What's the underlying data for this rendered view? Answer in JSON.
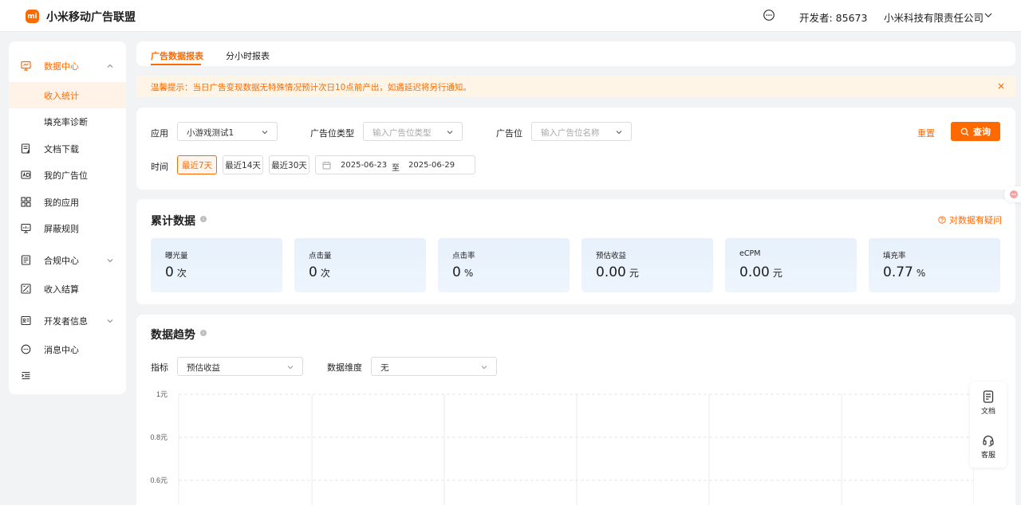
{
  "header": {
    "logo_text": "mi",
    "app_title": "小米移动广告联盟",
    "developer": "开发者: 85673",
    "company": "小米科技有限责任公司"
  },
  "sidebar": {
    "items": [
      {
        "label": "数据中心",
        "icon": "monitor-icon"
      },
      {
        "label": "收入统计"
      },
      {
        "label": "填充率诊断"
      },
      {
        "label": "文档下载",
        "icon": "document-download-icon"
      },
      {
        "label": "我的广告位",
        "icon": "ad-slot-icon"
      },
      {
        "label": "我的应用",
        "icon": "apps-grid-icon"
      },
      {
        "label": "屏蔽规则",
        "icon": "shield-rule-icon"
      },
      {
        "label": "合规中心",
        "icon": "compliance-icon"
      },
      {
        "label": "收入结算",
        "icon": "settlement-icon"
      },
      {
        "label": "开发者信息",
        "icon": "developer-card-icon"
      },
      {
        "label": "消息中心",
        "icon": "chat-icon"
      }
    ]
  },
  "tabs": [
    {
      "label": "广告数据报表",
      "active": true
    },
    {
      "label": "分小时报表",
      "active": false
    }
  ],
  "notice": {
    "text": "温馨提示：当日广告变现数据无特殊情况预计次日10点前产出，如遇延迟将另行通知。"
  },
  "filters": {
    "app_label": "应用",
    "app_value": "小游戏测试1",
    "slot_type_label": "广告位类型",
    "slot_type_placeholder": "输入广告位类型",
    "slot_label": "广告位",
    "slot_placeholder": "输入广告位名称",
    "reset_label": "重置",
    "query_label": "查询",
    "time_label": "时间",
    "time_options": [
      "最近7天",
      "最近14天",
      "最近30天"
    ],
    "date_start": "2025-06-23",
    "date_sep": "至",
    "date_end": "2025-06-29"
  },
  "summary": {
    "title": "累计数据",
    "question_link": "对数据有疑问",
    "stats": [
      {
        "label": "曝光量",
        "value": "0",
        "unit": "次"
      },
      {
        "label": "点击量",
        "value": "0",
        "unit": "次"
      },
      {
        "label": "点击率",
        "value": "0",
        "unit": "%"
      },
      {
        "label": "预估收益",
        "value": "0.00",
        "unit": "元"
      },
      {
        "label": "eCPM",
        "value": "0.00",
        "unit": "元"
      },
      {
        "label": "填充率",
        "value": "0.77",
        "unit": "%"
      }
    ]
  },
  "trend": {
    "title": "数据趋势",
    "metric_label": "指标",
    "metric_value": "预估收益",
    "dimension_label": "数据维度",
    "dimension_value": "无"
  },
  "float_panel": {
    "docs_label": "文档",
    "service_label": "客服"
  },
  "chart_data": {
    "type": "line",
    "y_ticks": [
      "1元",
      "0.8元",
      "0.6元"
    ],
    "ylim": [
      0,
      1
    ],
    "grid": true,
    "x": [],
    "series": []
  },
  "colors": {
    "accent": "#ff6900",
    "notice_bg": "#fff5e6",
    "stat_bg": "#e7f1fc"
  }
}
